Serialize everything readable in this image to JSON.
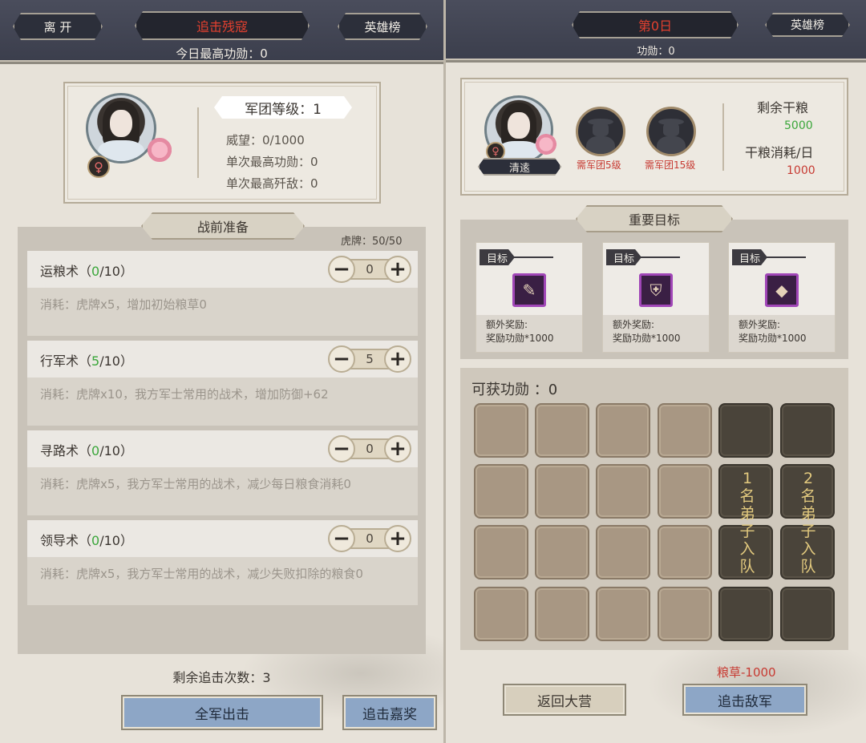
{
  "left": {
    "leave_label": "离 开",
    "title": "追击残寇",
    "heroes_label": "英雄榜",
    "today_best": "今日最高功勋：0",
    "legion_level": "军团等级：1",
    "prestige": "威望：0/1000",
    "single_best_merit": "单次最高功勋：0",
    "single_best_kills": "单次最高歼敌：0",
    "prep_title": "战前准备",
    "tiger_tokens": "虎牌：50/50",
    "skills": [
      {
        "name": "运粮术（",
        "level": "0",
        "max": "/10）",
        "value": "0",
        "desc": "消耗：虎牌x5，增加初始粮草0"
      },
      {
        "name": "行军术（",
        "level": "5",
        "max": "/10）",
        "value": "5",
        "desc": "消耗：虎牌x10，我方军士常用的战术，增加防御+62"
      },
      {
        "name": "寻路术（",
        "level": "0",
        "max": "/10）",
        "value": "0",
        "desc": "消耗：虎牌x5，我方军士常用的战术，减少每日粮食消耗0"
      },
      {
        "name": "领导术（",
        "level": "0",
        "max": "/10）",
        "value": "0",
        "desc": "消耗：虎牌x5，我方军士常用的战术，减少失败扣除的粮食0"
      }
    ],
    "remaining_chases": "剩余追击次数：3",
    "all_out_label": "全军出击",
    "chase_reward_label": "追击嘉奖",
    "gender_symbol": "♀"
  },
  "right": {
    "day_title": "第0日",
    "heroes_label": "英雄榜",
    "merit": "功勋：0",
    "hero_name": "清逺",
    "lock1": "需军团5级",
    "lock2": "需军团15级",
    "food_left_label": "剩余干粮",
    "food_left_value": "5000",
    "food_use_label": "干粮消耗/日",
    "food_use_value": "1000",
    "goals_title": "重要目标",
    "goals": [
      {
        "tag": "目标",
        "icon": "scroll-icon",
        "reward_label": "额外奖励:",
        "reward": "奖励功勋*1000"
      },
      {
        "tag": "目标",
        "icon": "armor-icon",
        "reward_label": "额外奖励:",
        "reward": "奖励功勋*1000"
      },
      {
        "tag": "目标",
        "icon": "ingot-icon",
        "reward_label": "额外奖励:",
        "reward": "奖励功勋*1000"
      }
    ],
    "obtainable_merit": "可获功勋 ：0",
    "disciple1": [
      "1",
      "名",
      "弟",
      "子",
      "入",
      "队"
    ],
    "disciple2": [
      "2",
      "名",
      "弟",
      "子",
      "入",
      "队"
    ],
    "grain_cost": "粮草-1000",
    "return_label": "返回大营",
    "chase_enemy_label": "追击敌军",
    "gender_symbol": "♀"
  },
  "colors": {
    "title_red": "#e2402f",
    "accent_green": "#3aa63a",
    "accent_red": "#c73a32",
    "button_blue": "#8da6c6"
  }
}
